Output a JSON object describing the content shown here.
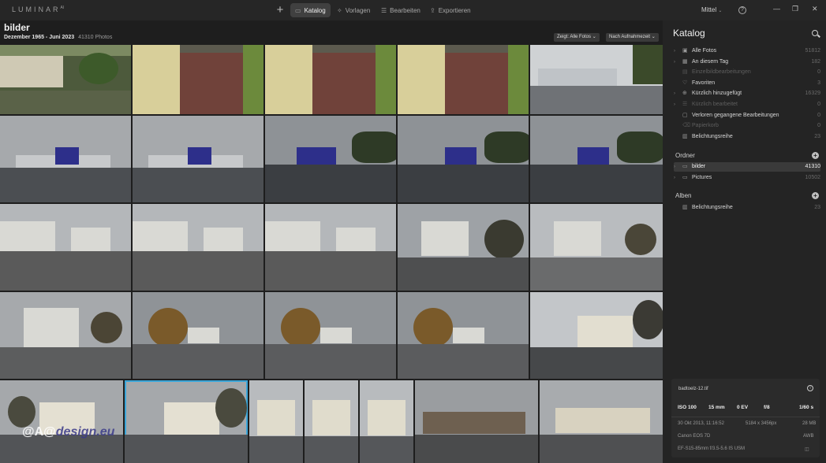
{
  "app": {
    "logo": "LUMINAR",
    "logo_version": "AI"
  },
  "nav": {
    "tabs": [
      {
        "label": "Katalog",
        "icon": "folder-icon",
        "active": true
      },
      {
        "label": "Vorlagen",
        "icon": "magic-icon",
        "active": false
      },
      {
        "label": "Bearbeiten",
        "icon": "sliders-icon",
        "active": false
      },
      {
        "label": "Exportieren",
        "icon": "share-icon",
        "active": false
      }
    ],
    "view_size": "Mittel"
  },
  "content": {
    "title": "bilder",
    "date_range": "Dezember 1965 - Juni 2023",
    "photo_count": "41310 Photos",
    "filter_show": "Zeigt: Alle Fotos",
    "sort": "Nach Aufnahmezeit"
  },
  "watermark": {
    "prefix": "@A@",
    "brand": "design.eu"
  },
  "sidebar": {
    "title": "Katalog",
    "items": [
      {
        "label": "Alle Fotos",
        "count": "51812",
        "icon": "photos-icon",
        "dim": false,
        "arrow": true
      },
      {
        "label": "An diesem Tag",
        "count": "182",
        "icon": "calendar-icon",
        "dim": false,
        "arrow": true
      },
      {
        "label": "Einzelbildbearbeitungen",
        "count": "0",
        "icon": "edit-icon",
        "dim": true,
        "arrow": false
      },
      {
        "label": "Favoriten",
        "count": "3",
        "icon": "heart-icon",
        "dim": false,
        "arrow": false
      },
      {
        "label": "Kürzlich hinzugefügt",
        "count": "16329",
        "icon": "plus-circle-icon",
        "dim": false,
        "arrow": true
      },
      {
        "label": "Kürzlich bearbeitet",
        "count": "0",
        "icon": "sliders-icon",
        "dim": true,
        "arrow": true
      },
      {
        "label": "Verloren gegangene Bearbeitungen",
        "count": "0",
        "icon": "image-icon",
        "dim": false,
        "arrow": false
      },
      {
        "label": "Papierkorb",
        "count": "0",
        "icon": "trash-icon",
        "dim": true,
        "arrow": false
      },
      {
        "label": "Belichtungsreihe",
        "count": "23",
        "icon": "stack-icon",
        "dim": false,
        "arrow": false
      }
    ],
    "folders_head": "Ordner",
    "folders": [
      {
        "label": "bilder",
        "count": "41310",
        "selected": true
      },
      {
        "label": "Pictures",
        "count": "10502",
        "selected": false
      }
    ],
    "albums_head": "Alben",
    "albums": [
      {
        "label": "Belichtungsreihe",
        "count": "23"
      }
    ]
  },
  "info": {
    "filename": "badtoelz-12.tif",
    "iso": "ISO 100",
    "focal": "15 mm",
    "ev": "0 EV",
    "aperture": "f/8",
    "shutter": "1/60 s",
    "date": "30 Okt 2013, 11:16:52",
    "dimensions": "5184 x 3456px",
    "size": "28 MB",
    "camera": "Canon EOS 7D",
    "wb": "AWB",
    "lens": "EF-S15-85mm f/3.5-5.6 IS USM"
  },
  "colors": {
    "accent": "#3aa6d9",
    "bg": "#1e1e1e",
    "panel": "#242424"
  }
}
